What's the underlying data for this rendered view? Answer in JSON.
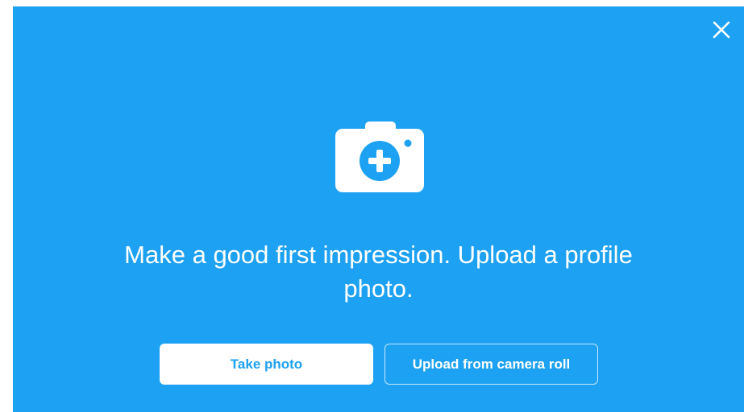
{
  "dialog": {
    "close_icon": "close-icon",
    "camera_icon": "camera-add-icon",
    "message": "Make a good first impression. Upload a profile photo.",
    "buttons": {
      "take_photo_label": "Take photo",
      "upload_label": "Upload from camera roll"
    }
  },
  "colors": {
    "background": "#1da1f2",
    "button_primary_bg": "#ffffff",
    "button_primary_text": "#1da1f2",
    "button_secondary_text": "#ffffff"
  }
}
